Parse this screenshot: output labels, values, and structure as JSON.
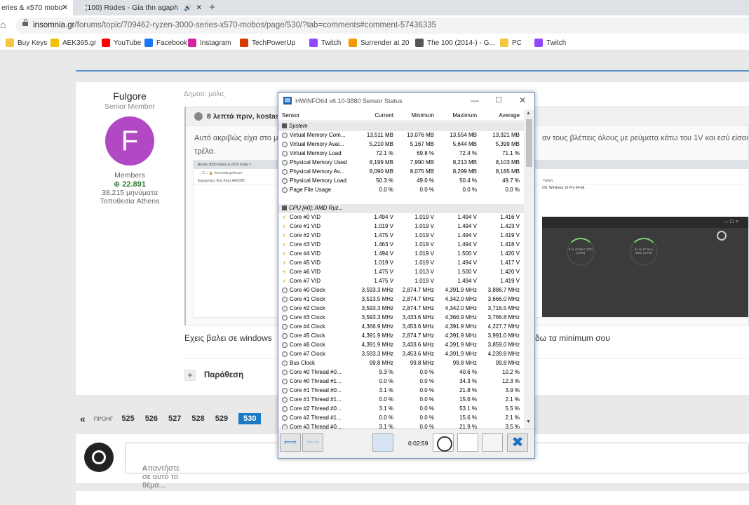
{
  "browser": {
    "tab1_title": "eries & x570 mobo",
    "tab1_close": "✕",
    "tab2_title": "(100) Rodes - Gia thn agaph",
    "tab2_speaker": "🔊",
    "tab2_close": "✕",
    "new_tab": "+",
    "url_host": "insomnia.gr",
    "url_path": "/forums/topic/709462-ryzen-3000-series-x570-mobos/page/530/?tab=comments#comment-57436335",
    "bookmarks": [
      {
        "label": "Buy Keys",
        "icon": "folder-icon",
        "color": "#f5c542"
      },
      {
        "label": "AEK365.gr",
        "icon": "aek-icon",
        "color": "#f2c200"
      },
      {
        "label": "YouTube",
        "icon": "youtube-icon",
        "color": "#ff0000"
      },
      {
        "label": "Facebook",
        "icon": "facebook-icon",
        "color": "#1877f2"
      },
      {
        "label": "Instagram",
        "icon": "instagram-icon",
        "color": "#d6249f"
      },
      {
        "label": "TechPowerUp",
        "icon": "techpowerup-icon",
        "color": "#d83b01"
      },
      {
        "label": "Twitch",
        "icon": "twitch-icon",
        "color": "#9146ff"
      },
      {
        "label": "Surrender at 20",
        "icon": "surrender-icon",
        "color": "#f29b00"
      },
      {
        "label": "The 100 (2014-) - G...",
        "icon": "globe-icon",
        "color": "#555555"
      },
      {
        "label": "PC",
        "icon": "folder-icon",
        "color": "#f5c542"
      },
      {
        "label": "Twitch",
        "icon": "twitch-icon",
        "color": "#9146ff"
      }
    ]
  },
  "post": {
    "author_name": "Fulgore",
    "author_rank": "Senior Member",
    "avatar_letter": "F",
    "group": "Members",
    "reputation": "22.891",
    "posts_count": "38.215 μηνύματα",
    "location": "Τοποθεσία Athens",
    "date": "Δημοσ. μόλις",
    "quote_author": "8 λεπτά πριν, kostas78",
    "quote_text_line1": "Αυτό ακριβώς είχα στο μ",
    "quote_text_line2": "τρέλα.",
    "quote_text_right": "αν τους βλέπεις όλους με ρεύματα κάτω του 1V και εσύ είσαι μ",
    "img_tab": "Ryzen 3000 series & x570 mobo ×",
    "img_addr": "→  C  ⌂   🔒 insomnia.gr/forum",
    "img_bm": "Εφαρμογές    Buy Keys   AEK365",
    "img_twitch": "Twitch",
    "img_os": "OS: Windows 10 Pro 64-bit",
    "img_window_controls": "— ☐ ×",
    "img_gauge1": "0 % 47.58 A TDC (CPU)",
    "img_gauge2": "21 % 47.58 A EDC (CPU)",
    "reply_text": "Εχεις βαλει σε windows",
    "reply_text_right": "δω τα minimum σου",
    "quote_button": "Παράθεση",
    "quote_plus": "+"
  },
  "pagination": {
    "first": "«",
    "prev": "ΠΡΟΗΓ",
    "pages": [
      "525",
      "526",
      "527",
      "528",
      "529"
    ],
    "current": "530"
  },
  "reply_box": {
    "placeholder": "Απαντήστε σε αυτό το θέμα..."
  },
  "hwinfo": {
    "title": "HWiNFO64 v6.10-3880 Sensor Status",
    "controls": {
      "min": "—",
      "max": "☐",
      "close": "✕"
    },
    "columns": [
      "Sensor",
      "Current",
      "Minimum",
      "Maximum",
      "Average"
    ],
    "rows": [
      {
        "g": true,
        "icon": "box",
        "n": "System",
        "v": [
          "",
          "",
          "",
          ""
        ]
      },
      {
        "icon": "circ",
        "n": "Virtual Memory Com...",
        "v": [
          "13,511 MB",
          "13,076 MB",
          "13,554 MB",
          "13,321 MB"
        ]
      },
      {
        "icon": "circ",
        "n": "Virtual Memory Avai...",
        "v": [
          "5,210 MB",
          "5,167 MB",
          "5,644 MB",
          "5,399 MB"
        ]
      },
      {
        "icon": "circ",
        "n": "Virtual Memory Load",
        "v": [
          "72.1 %",
          "69.8 %",
          "72.4 %",
          "71.1 %"
        ]
      },
      {
        "icon": "circ",
        "n": "Physical Memory Used",
        "v": [
          "8,199 MB",
          "7,990 MB",
          "8,213 MB",
          "8,103 MB"
        ]
      },
      {
        "icon": "circ",
        "n": "Physical Memory Av...",
        "v": [
          "8,090 MB",
          "8,075 MB",
          "8,299 MB",
          "8,185 MB"
        ]
      },
      {
        "icon": "circ",
        "n": "Physical Memory Load",
        "v": [
          "50.3 %",
          "49.0 %",
          "50.4 %",
          "49.7 %"
        ]
      },
      {
        "icon": "circ",
        "n": "Page File Usage",
        "v": [
          "0.0 %",
          "0.0 %",
          "0.0 %",
          "0.0 %"
        ]
      },
      {
        "blank": true,
        "n": "",
        "v": [
          "",
          "",
          "",
          ""
        ]
      },
      {
        "g": true,
        "icon": "box",
        "n": "CPU [#0]: AMD Ryz...",
        "v": [
          "",
          "",
          "",
          ""
        ]
      },
      {
        "icon": "volt",
        "n": "Core #0 VID",
        "v": [
          "1.494 V",
          "1.019 V",
          "1.494 V",
          "1.416 V"
        ]
      },
      {
        "icon": "volt",
        "n": "Core #1 VID",
        "v": [
          "1.019 V",
          "1.019 V",
          "1.494 V",
          "1.423 V"
        ]
      },
      {
        "icon": "volt",
        "n": "Core #2 VID",
        "v": [
          "1.475 V",
          "1.019 V",
          "1.494 V",
          "1.419 V"
        ]
      },
      {
        "icon": "volt",
        "n": "Core #3 VID",
        "v": [
          "1.463 V",
          "1.019 V",
          "1.494 V",
          "1.418 V"
        ]
      },
      {
        "icon": "volt",
        "n": "Core #4 VID",
        "v": [
          "1.494 V",
          "1.019 V",
          "1.500 V",
          "1.420 V"
        ]
      },
      {
        "icon": "volt",
        "n": "Core #5 VID",
        "v": [
          "1.019 V",
          "1.019 V",
          "1.494 V",
          "1.417 V"
        ]
      },
      {
        "icon": "volt",
        "n": "Core #6 VID",
        "v": [
          "1.475 V",
          "1.013 V",
          "1.500 V",
          "1.420 V"
        ]
      },
      {
        "icon": "volt",
        "n": "Core #7 VID",
        "v": [
          "1.475 V",
          "1.019 V",
          "1.494 V",
          "1.419 V"
        ]
      },
      {
        "icon": "circ",
        "n": "Core #0 Clock",
        "v": [
          "3,593.3 MHz",
          "2,874.7 MHz",
          "4,391.9 MHz",
          "3,886.7 MHz"
        ]
      },
      {
        "icon": "circ",
        "n": "Core #1 Clock",
        "v": [
          "3,513.5 MHz",
          "2,874.7 MHz",
          "4,342.0 MHz",
          "3,666.0 MHz"
        ]
      },
      {
        "icon": "circ",
        "n": "Core #2 Clock",
        "v": [
          "3,593.3 MHz",
          "2,874.7 MHz",
          "4,342.0 MHz",
          "3,716.5 MHz"
        ]
      },
      {
        "icon": "circ",
        "n": "Core #3 Clock",
        "v": [
          "3,593.3 MHz",
          "3,433.6 MHz",
          "4,366.9 MHz",
          "3,766.8 MHz"
        ]
      },
      {
        "icon": "circ",
        "n": "Core #4 Clock",
        "v": [
          "4,366.9 MHz",
          "3,453.6 MHz",
          "4,391.9 MHz",
          "4,227.7 MHz"
        ]
      },
      {
        "icon": "circ",
        "n": "Core #5 Clock",
        "v": [
          "4,391.9 MHz",
          "2,874.7 MHz",
          "4,391.9 MHz",
          "3,991.0 MHz"
        ]
      },
      {
        "icon": "circ",
        "n": "Core #6 Clock",
        "v": [
          "4,391.9 MHz",
          "3,433.6 MHz",
          "4,391.9 MHz",
          "3,859.0 MHz"
        ]
      },
      {
        "icon": "circ",
        "n": "Core #7 Clock",
        "v": [
          "3,593.3 MHz",
          "3,453.6 MHz",
          "4,391.9 MHz",
          "4,239.8 MHz"
        ]
      },
      {
        "icon": "circ",
        "n": "Bus Clock",
        "v": [
          "99.8 MHz",
          "99.8 MHz",
          "99.8 MHz",
          "99.8 MHz"
        ]
      },
      {
        "icon": "circ",
        "n": "Core #0 Thread #0...",
        "v": [
          "9.3 %",
          "0.0 %",
          "40.6 %",
          "10.2 %"
        ]
      },
      {
        "icon": "circ",
        "n": "Core #0 Thread #1...",
        "v": [
          "0.0 %",
          "0.0 %",
          "34.3 %",
          "12.3 %"
        ]
      },
      {
        "icon": "circ",
        "n": "Core #1 Thread #0...",
        "v": [
          "3.1 %",
          "0.0 %",
          "21.8 %",
          "3.9 %"
        ]
      },
      {
        "icon": "circ",
        "n": "Core #1 Thread #1...",
        "v": [
          "0.0 %",
          "0.0 %",
          "15.6 %",
          "2.1 %"
        ]
      },
      {
        "icon": "circ",
        "n": "Core #2 Thread #0...",
        "v": [
          "3.1 %",
          "0.0 %",
          "53.1 %",
          "5.5 %"
        ]
      },
      {
        "icon": "circ",
        "n": "Core #2 Thread #1...",
        "v": [
          "0.0 %",
          "0.0 %",
          "15.6 %",
          "2.1 %"
        ]
      },
      {
        "icon": "circ",
        "n": "Core #3 Thread #0...",
        "v": [
          "3.1 %",
          "0.0 %",
          "21.9 %",
          "3.5 %"
        ]
      }
    ],
    "footer": {
      "nav_left": "⇦⇨",
      "nav_right": "⇦⇨",
      "elapsed": "0:02:59",
      "close": "✖"
    }
  }
}
